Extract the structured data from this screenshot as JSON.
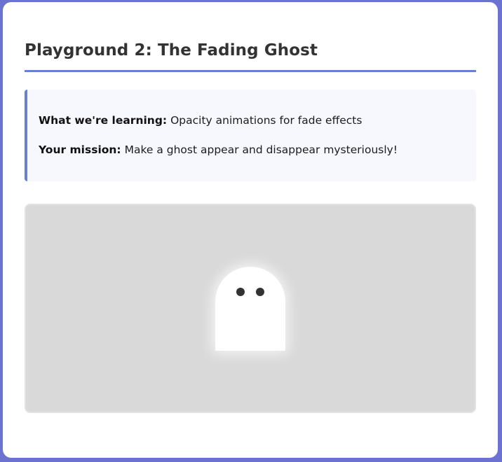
{
  "page": {
    "title": "Playground 2: The Fading Ghost",
    "accent_color": "#6680d6",
    "background_color": "#6b72cf"
  },
  "info": {
    "learning_label": "What we're learning:",
    "learning_text": "Opacity animations for fade effects",
    "mission_label": "Your mission:",
    "mission_text": "Make a ghost appear and disappear mysteriously!"
  },
  "stage": {
    "background_color": "#d9d9d9",
    "ghost": {
      "icon": "ghost-icon",
      "color": "#ffffff",
      "eye_color": "#333333",
      "opacity": 1
    }
  }
}
